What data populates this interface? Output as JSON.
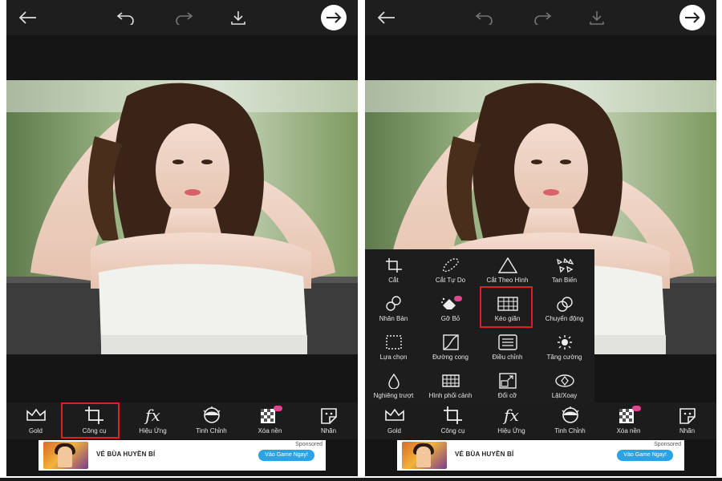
{
  "top_icons": {
    "back": "arrow-left-icon",
    "undo": "undo-icon",
    "redo": "redo-icon",
    "save": "download-icon",
    "next": "arrow-right-circle-icon"
  },
  "toolbar": {
    "items": [
      {
        "label": "Gold",
        "icon": "crown-icon"
      },
      {
        "label": "Công cụ",
        "icon": "crop-icon"
      },
      {
        "label": "Hiệu Ứng",
        "icon": "fx-icon"
      },
      {
        "label": "Tinh Chỉnh",
        "icon": "face-retouch-icon"
      },
      {
        "label": "Xóa nền",
        "icon": "remove-background-icon"
      },
      {
        "label": "Nhãn",
        "icon": "sticker-icon"
      }
    ]
  },
  "tools_menu": {
    "items": [
      {
        "label": "Cắt",
        "icon": "crop-icon"
      },
      {
        "label": "Cắt Tự Do",
        "icon": "freecrop-icon"
      },
      {
        "label": "Cắt Theo Hình",
        "icon": "triangle-icon"
      },
      {
        "label": "Tan Biến",
        "icon": "dispersion-icon"
      },
      {
        "label": "Nhân Bản",
        "icon": "clone-icon"
      },
      {
        "label": "Gỡ Bỏ",
        "icon": "eraser-icon"
      },
      {
        "label": "Kéo giãn",
        "icon": "stretch-icon"
      },
      {
        "label": "Chuyển động",
        "icon": "motion-icon"
      },
      {
        "label": "Lựa chọn",
        "icon": "select-icon"
      },
      {
        "label": "Đường cong",
        "icon": "curves-icon"
      },
      {
        "label": "Điều chỉnh",
        "icon": "adjust-icon"
      },
      {
        "label": "Tăng cường",
        "icon": "enhance-icon"
      },
      {
        "label": "Nghiêng trượt",
        "icon": "tilt-shift-icon"
      },
      {
        "label": "Hình phối cảnh",
        "icon": "perspective-icon"
      },
      {
        "label": "Đổi cỡ",
        "icon": "resize-icon"
      },
      {
        "label": "Lật/Xoay",
        "icon": "flip-rotate-icon"
      }
    ],
    "highlighted": "Kéo giãn"
  },
  "ad": {
    "sponsored": "Sponsored",
    "title": "VÉ BÙA HUYỀN BÍ",
    "cta": "Vào Game Ngay!"
  },
  "colors": {
    "highlight": "#e02020",
    "background": "#151515",
    "cta": "#2aa3e6"
  }
}
